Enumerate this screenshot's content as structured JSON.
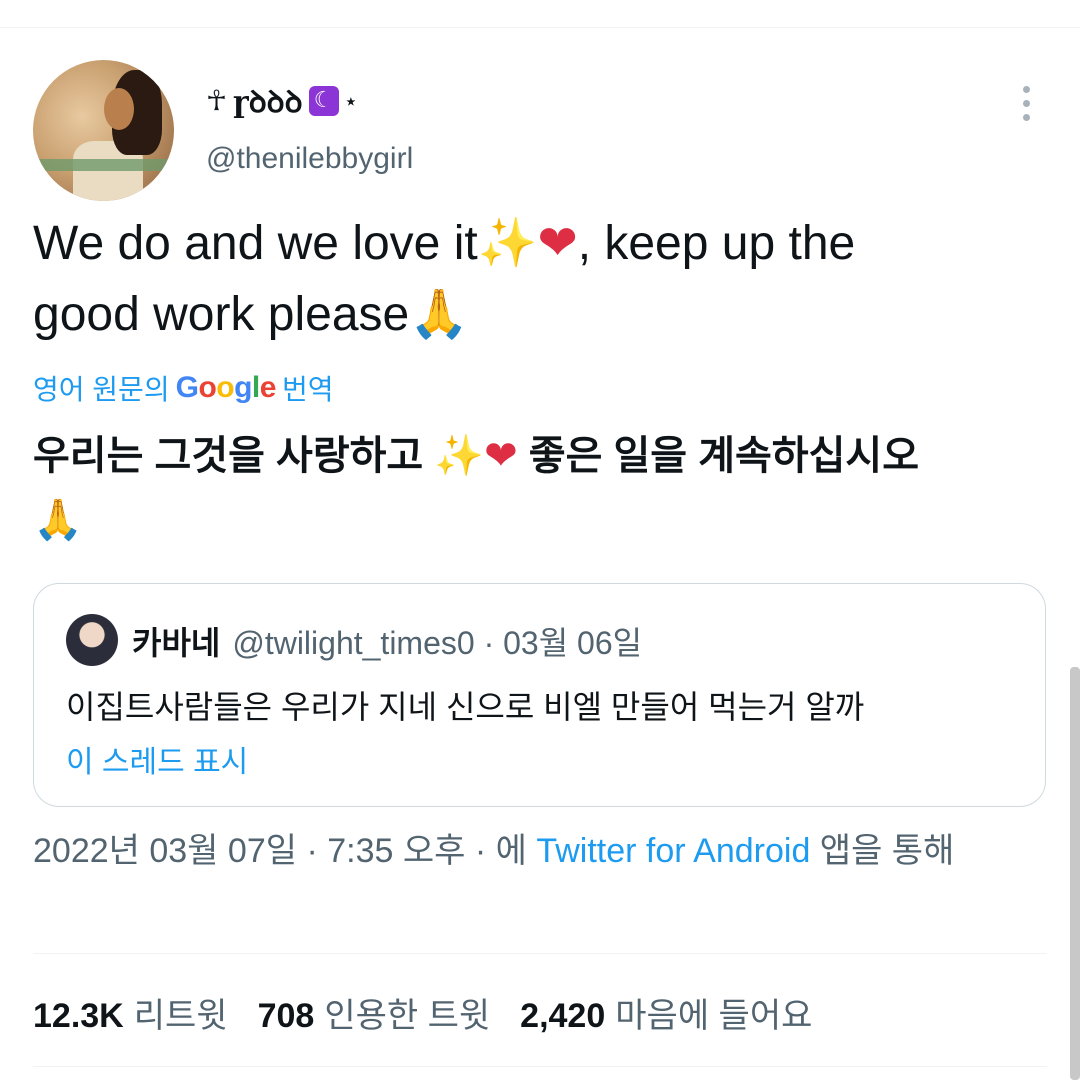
{
  "author": {
    "display_name": "ɼꝺꝺꝺ",
    "ankh_icon": "☥",
    "moon_icon": "☾",
    "star_icon": "⋆",
    "handle": "@thenilebbygirl"
  },
  "tweet": {
    "line1_text": "We do and we love it",
    "line1_sparkle": "✨",
    "line1_heart": "❤",
    "line1_rest": ", keep up the",
    "line2_text": "good work please",
    "line2_pray": "🙏"
  },
  "translation": {
    "prefix": "영어 원문의",
    "google_letters": [
      "G",
      "o",
      "o",
      "g",
      "l",
      "e"
    ],
    "suffix": "번역",
    "text_part1": "우리는 그것을 사랑하고 ",
    "sparkle": "✨",
    "heart": "❤",
    "text_part2": " 좋은 일을 계속하십시오",
    "pray": "🙏"
  },
  "quoted_tweet": {
    "name": "카바네",
    "meta": "@twilight_times0 · 03월 06일",
    "text": "이집트사람들은 우리가 지네 신으로 비엘 만들어 먹는거 알까",
    "show_thread": "이 스레드 표시"
  },
  "timestamp": {
    "date_time": "2022년 03월 07일 · 7:35 오후 · 에 ",
    "source": "Twitter for Android",
    "suffix": " 앱을 통해"
  },
  "stats": {
    "retweets": {
      "count": "12.3K",
      "label": "리트윗"
    },
    "quotes": {
      "count": "708",
      "label": "인용한 트윗"
    },
    "likes": {
      "count": "2,420",
      "label": "마음에 들어요"
    }
  },
  "colors": {
    "link_blue": "#1d9bf0",
    "secondary_text": "#536471",
    "heart_red": "#dd2e44",
    "moon_purple": "#8b35d6"
  }
}
